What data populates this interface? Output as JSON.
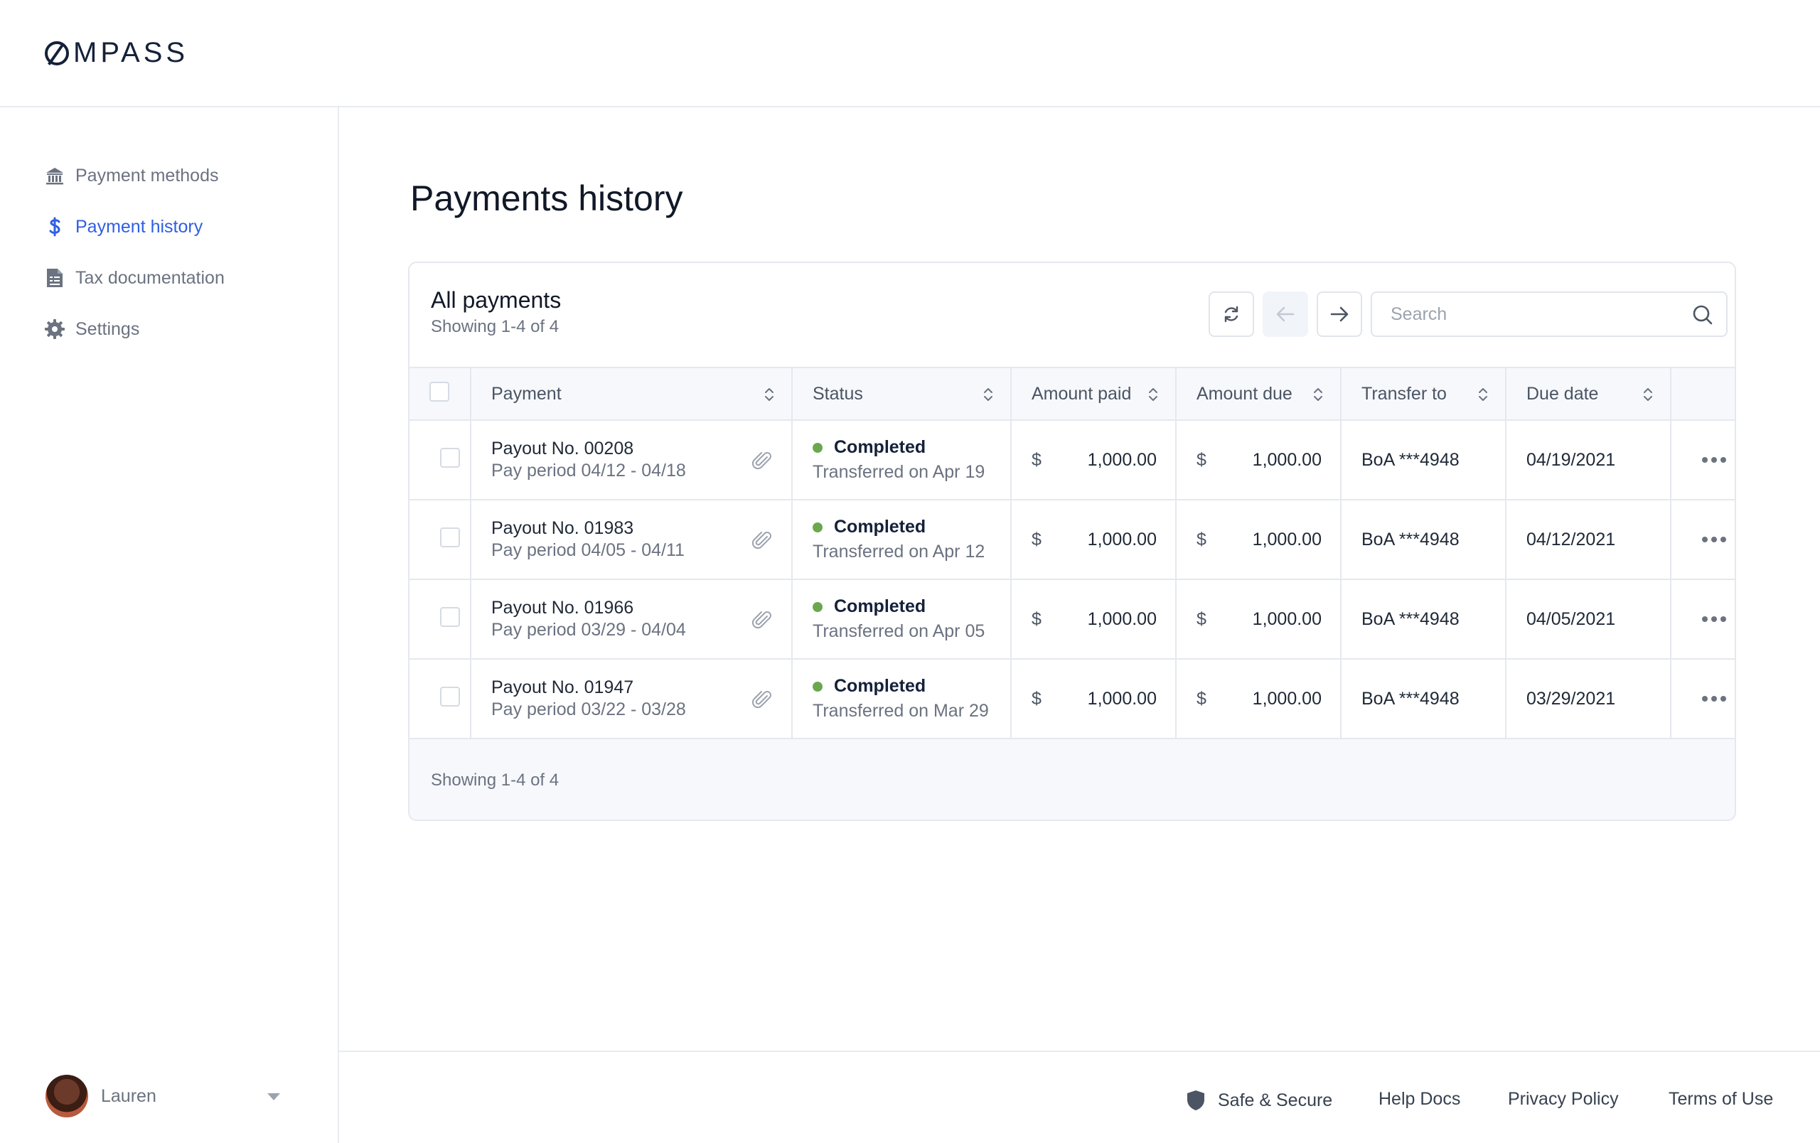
{
  "brand": {
    "logo_text": "MPASS"
  },
  "sidebar": {
    "items": [
      {
        "label": "Payment methods",
        "icon": "bank-icon",
        "active": false
      },
      {
        "label": "Payment history",
        "icon": "dollar-icon",
        "active": true
      },
      {
        "label": "Tax documentation",
        "icon": "document-icon",
        "active": false
      },
      {
        "label": "Settings",
        "icon": "gear-icon",
        "active": false
      }
    ],
    "user": {
      "name": "Lauren"
    }
  },
  "main": {
    "title": "Payments history",
    "card": {
      "title": "All payments",
      "subtitle": "Showing 1-4 of 4",
      "search_placeholder": "Search",
      "footer_text": "Showing 1-4 of 4"
    },
    "table": {
      "columns": [
        "Payment",
        "Status",
        "Amount paid",
        "Amount due",
        "Transfer to",
        "Due date"
      ],
      "rows": [
        {
          "payment": "Payout No. 00208",
          "period": "Pay period 04/12 - 04/18",
          "status": "Completed",
          "status_sub": "Transferred on Apr 19",
          "currency_paid": "$",
          "amount_paid": "1,000.00",
          "currency_due": "$",
          "amount_due": "1,000.00",
          "transfer_to": "BoA ***4948",
          "due_date": "04/19/2021"
        },
        {
          "payment": "Payout No. 01983",
          "period": "Pay period 04/05 - 04/11",
          "status": "Completed",
          "status_sub": "Transferred on Apr 12",
          "currency_paid": "$",
          "amount_paid": "1,000.00",
          "currency_due": "$",
          "amount_due": "1,000.00",
          "transfer_to": "BoA ***4948",
          "due_date": "04/12/2021"
        },
        {
          "payment": "Payout No. 01966",
          "period": "Pay period 03/29 - 04/04",
          "status": "Completed",
          "status_sub": "Transferred on Apr 05",
          "currency_paid": "$",
          "amount_paid": "1,000.00",
          "currency_due": "$",
          "amount_due": "1,000.00",
          "transfer_to": "BoA ***4948",
          "due_date": "04/05/2021"
        },
        {
          "payment": "Payout No. 01947",
          "period": "Pay period 03/22 - 03/28",
          "status": "Completed",
          "status_sub": "Transferred on Mar 29",
          "currency_paid": "$",
          "amount_paid": "1,000.00",
          "currency_due": "$",
          "amount_due": "1,000.00",
          "transfer_to": "BoA ***4948",
          "due_date": "03/29/2021"
        }
      ]
    }
  },
  "footer": {
    "links": [
      "Safe & Secure",
      "Help Docs",
      "Privacy Policy",
      "Terms of Use"
    ]
  },
  "colors": {
    "accent": "#2f5fe3",
    "status_completed": "#6aa84f",
    "brand_dark": "#15213a"
  }
}
